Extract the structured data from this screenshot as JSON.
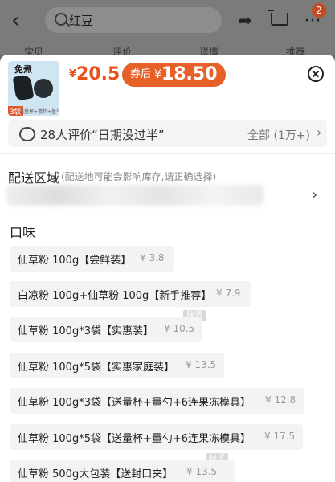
{
  "header": {
    "search_query": "红豆",
    "cart_badge": "2",
    "bg_tabs": [
      "宝贝",
      "评价",
      "详情",
      "推荐"
    ]
  },
  "sku": {
    "thumb": {
      "tag_top": "免煮",
      "tag_bottom": "3袋",
      "tag_note": "送量杯+搅拌+量勺"
    },
    "price_cur": "¥",
    "price": "20.5",
    "coupon_label": "券后",
    "coupon_cur": "¥",
    "coupon_price": "18.50",
    "review_text": "28人评价“日期没过半”",
    "review_all": "全部 (1万+)",
    "shipping_title": "配送区域",
    "shipping_note": "(配送地可能会影响库存,请正确选择)",
    "flavor_title": "口味",
    "options": [
      {
        "name": "仙草粉 100g【尝鲜装】",
        "price": "¥ 3.8",
        "stock": ""
      },
      {
        "name": "白凉粉 100g+仙草粉 100g【新手推荐】",
        "price": "¥ 7.9",
        "stock": ""
      },
      {
        "name": "仙草粉 100g*3袋【实惠装】",
        "price": "¥ 10.5",
        "stock": "缺货"
      },
      {
        "name": "仙草粉 100g*5袋【实惠家庭装】",
        "price": "¥ 13.5",
        "stock": ""
      },
      {
        "name": "仙草粉 100g*3袋【送量杯+量勺+6连果冻模具】",
        "price": "¥ 12.8",
        "stock": ""
      },
      {
        "name": "仙草粉 100g*5袋【送量杯+量勺+6连果冻模具】",
        "price": "¥ 17.5",
        "stock": ""
      },
      {
        "name": "仙草粉 500g大包装【送封口夹】",
        "price": "¥ 13.5",
        "stock": "缺货"
      }
    ]
  },
  "colors": {
    "accent": "#e8501c",
    "coupon_bg": "#e66128",
    "option_bg": "#f3f3f3"
  }
}
